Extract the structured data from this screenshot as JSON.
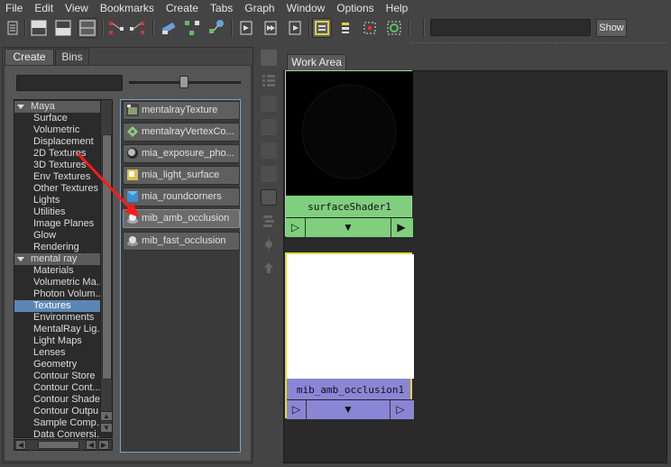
{
  "menu": [
    "File",
    "Edit",
    "View",
    "Bookmarks",
    "Create",
    "Tabs",
    "Graph",
    "Window",
    "Options",
    "Help"
  ],
  "toolbar": {
    "show_label": "Show",
    "search_value": "",
    "icons": [
      "hypershade-list-icon",
      "layout-top-icon",
      "layout-bottom-icon",
      "layout-split-icon",
      "input-connections-icon",
      "output-connections-icon",
      "clear-graph-icon",
      "rearrange-graph-icon",
      "graph-materials-icon",
      "graph-up-icon",
      "graph-down-icon",
      "graph-updown-icon",
      "swatch-icon",
      "filter-icon",
      "bookmark-icon",
      "frame-icon"
    ]
  },
  "left_tabs": {
    "create": "Create",
    "bins": "Bins"
  },
  "filter": {
    "value": ""
  },
  "tree": {
    "maya_header": "Maya",
    "maya_items": [
      "Surface",
      "Volumetric",
      "Displacement",
      "2D Textures",
      "3D Textures",
      "Env Textures",
      "Other Textures",
      "Lights",
      "Utilities",
      "Image Planes",
      "Glow",
      "Rendering"
    ],
    "mr_header": "mental ray",
    "mr_items": [
      "Materials",
      "Volumetric Ma...",
      "Photon Volum...",
      "Textures",
      "Environments",
      "MentalRay Lig...",
      "Light Maps",
      "Lenses",
      "Geometry",
      "Contour Store",
      "Contour Cont...",
      "Contour Shade",
      "Contour Outpu",
      "Sample Comp...",
      "Data Conversi..."
    ],
    "selected": "Textures"
  },
  "nodes_list": [
    {
      "label": "mentalrayTexture",
      "icon": "texture-file-icon",
      "color": "#8aa070"
    },
    {
      "label": "mentalrayVertexCo...",
      "icon": "vertex-colors-icon",
      "color": "#9acb6a"
    },
    {
      "label": "mia_exposure_pho...",
      "icon": "exposure-icon",
      "color": "#9a9a9a"
    },
    {
      "label": "mia_light_surface",
      "icon": "light-surface-icon",
      "color": "#d6c24a"
    },
    {
      "label": "mia_roundcorners",
      "icon": "roundcorners-icon",
      "color": "#3a8fd6"
    },
    {
      "label": "mib_amb_occlusion",
      "icon": "amb-occlusion-icon",
      "color": "#e8e8e8"
    },
    {
      "label": "mib_fast_occlusion",
      "icon": "fast-occlusion-icon",
      "color": "#cfcfcf"
    }
  ],
  "workarea": {
    "tab": "Work Area",
    "node1": {
      "label": "surfaceShader1",
      "color": "#7fcf7f",
      "swatch": "#000000",
      "border": "#9fdf9f"
    },
    "node2": {
      "label": "mib_amb_occlusion1",
      "color": "#8a86d6",
      "swatch": "#ffffff",
      "border": "#e4d83a"
    }
  },
  "annotation": {
    "color": "#ff1a1a"
  }
}
